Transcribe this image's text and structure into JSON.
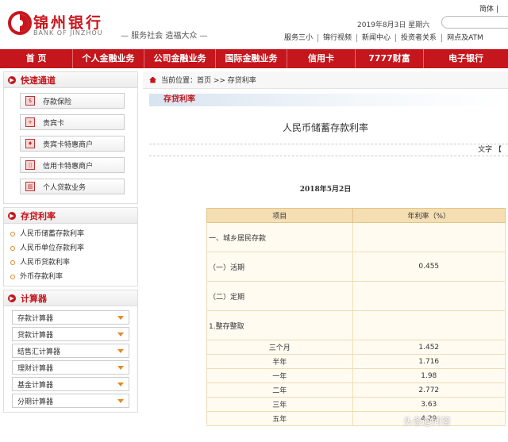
{
  "header": {
    "bank_name_cn": "锦州银行",
    "bank_name_en": "BANK OF JINZHOU",
    "slogan": "— 服务社会 造福大众 —",
    "lang": "简体 |",
    "date": "2019年8月3日  星期六",
    "top_links": [
      "服务三小",
      "锦行视频",
      "新闻中心",
      "投资者关系",
      "网点及ATM"
    ]
  },
  "nav": [
    "首 页",
    "个人金融业务",
    "公司金融业务",
    "国际金融业务",
    "信用卡",
    "7777财富",
    "电子银行"
  ],
  "sidebar": {
    "quick": {
      "title": "快速通道",
      "items": [
        "存款保险",
        "贵宾卡",
        "贵宾卡特惠商户",
        "信用卡特惠商户",
        "个人贷款业务"
      ]
    },
    "rates": {
      "title": "存贷利率",
      "items": [
        "人民币储蓄存款利率",
        "人民币单位存款利率",
        "人民币贷款利率",
        "外币存款利率"
      ]
    },
    "calculators": {
      "title": "计算器",
      "items": [
        "存款计算器",
        "贷款计算器",
        "结售汇计算器",
        "理财计算器",
        "基金计算器",
        "分期计算器"
      ]
    }
  },
  "content": {
    "breadcrumb": "当前位置：首页 >> 存贷利率",
    "section_title": "存贷利率",
    "article_title": "人民币储蓄存款利率",
    "toolbar_text": "文字 【",
    "pub_date": "2018年5月2日",
    "table": {
      "headers": [
        "项目",
        "年利率（%）"
      ],
      "rows": [
        {
          "name": "一、城乡居民存款",
          "value": "",
          "tall": true
        },
        {
          "name": "（一）活期",
          "value": "0.455",
          "tall": true
        },
        {
          "name": "（二）定期",
          "value": "",
          "tall": true
        },
        {
          "name": "1.整存整取",
          "value": "",
          "tall": true
        },
        {
          "name": "三个月",
          "value": "1.452",
          "tall": false,
          "indent": true
        },
        {
          "name": "半年",
          "value": "1.716",
          "tall": false,
          "indent": true
        },
        {
          "name": "一年",
          "value": "1.98",
          "tall": false,
          "indent": true
        },
        {
          "name": "二年",
          "value": "2.772",
          "tall": false,
          "indent": true
        },
        {
          "name": "三年",
          "value": "3.63",
          "tall": false,
          "indent": true
        },
        {
          "name": "五年",
          "value": "4.29",
          "tall": false,
          "indent": true
        }
      ]
    }
  },
  "watermark": "头条@问答"
}
